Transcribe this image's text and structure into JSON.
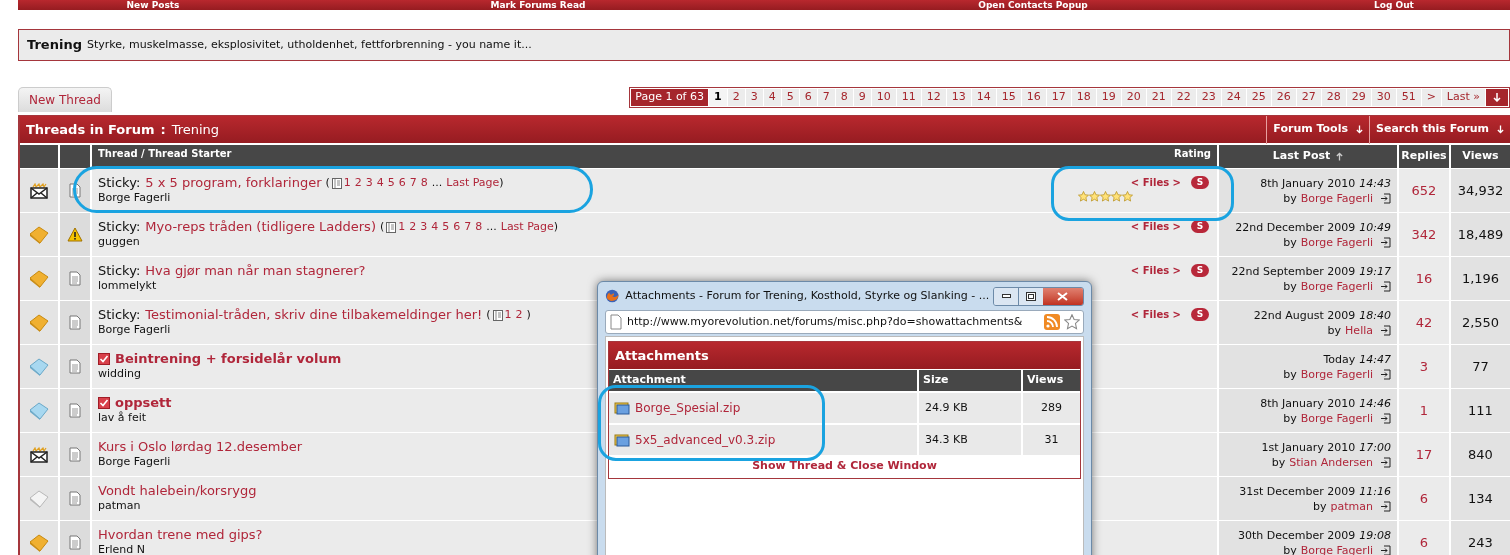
{
  "nav": [
    "New Posts",
    "Mark Forums Read",
    "Open Contacts Popup",
    "Log Out"
  ],
  "forum": {
    "title": "Trening",
    "description": "Styrke, muskelmasse, eksplosivitet, utholdenhet, fettforbrenning - you name it..."
  },
  "new_thread": "New Thread",
  "pagination": {
    "label": "Page 1 of 63",
    "pages": [
      {
        "label": "1",
        "selected": true
      },
      {
        "label": "2",
        "selected": false
      },
      {
        "label": "3",
        "selected": false
      },
      {
        "label": "4",
        "selected": false
      },
      {
        "label": "5",
        "selected": false
      },
      {
        "label": "6",
        "selected": false
      },
      {
        "label": "7",
        "selected": false
      },
      {
        "label": "8",
        "selected": false
      },
      {
        "label": "9",
        "selected": false
      },
      {
        "label": "10",
        "selected": false
      },
      {
        "label": "11",
        "selected": false
      },
      {
        "label": "12",
        "selected": false
      },
      {
        "label": "13",
        "selected": false
      },
      {
        "label": "14",
        "selected": false
      },
      {
        "label": "15",
        "selected": false
      },
      {
        "label": "16",
        "selected": false
      },
      {
        "label": "17",
        "selected": false
      },
      {
        "label": "18",
        "selected": false
      },
      {
        "label": "19",
        "selected": false
      },
      {
        "label": "20",
        "selected": false
      },
      {
        "label": "21",
        "selected": false
      },
      {
        "label": "22",
        "selected": false
      },
      {
        "label": "23",
        "selected": false
      },
      {
        "label": "24",
        "selected": false
      },
      {
        "label": "25",
        "selected": false
      },
      {
        "label": "26",
        "selected": false
      },
      {
        "label": "27",
        "selected": false
      },
      {
        "label": "28",
        "selected": false
      },
      {
        "label": "29",
        "selected": false
      },
      {
        "label": "30",
        "selected": false
      },
      {
        "label": "51",
        "selected": false
      },
      {
        "label": ">",
        "selected": false
      },
      {
        "label": "Last »",
        "selected": false
      }
    ]
  },
  "threads_header": {
    "title": "Threads in Forum",
    "separator": ":",
    "forum": "Trening",
    "tools": [
      "Forum Tools",
      "Search this Forum"
    ]
  },
  "columns": [
    "Thread / Thread Starter",
    "Rating",
    "Last Post",
    "Replies",
    "Views"
  ],
  "rows": [
    {
      "status_icon": {
        "kind": "envelope"
      },
      "post_icon": {
        "kind": "document"
      },
      "prefix": "Sticky:",
      "flagged": false,
      "title": "5 x 5 program, forklaringer",
      "page_links": {
        "open": "(",
        "pages": [
          "1",
          "2",
          "3",
          "4",
          "5",
          "6",
          "7",
          "8"
        ],
        "ellipsis": "...",
        "last": "Last Page",
        "close": ")"
      },
      "starter": "Borge Fagerli",
      "files": "< Files >",
      "badge": "S",
      "stars": 5,
      "last_post": {
        "date": "8th January 2010",
        "time": "14:43",
        "by": "by",
        "user": "Borge Fagerli"
      },
      "replies": "652",
      "views": "34,932"
    },
    {
      "status_icon": {
        "kind": "gold"
      },
      "post_icon": {
        "kind": "warning"
      },
      "prefix": "Sticky:",
      "flagged": false,
      "title": "Myo-reps tråden (tidligere Ladders)",
      "page_links": {
        "open": "(",
        "pages": [
          "1",
          "2",
          "3",
          "4",
          "5",
          "6",
          "7",
          "8"
        ],
        "ellipsis": "...",
        "last": "Last Page",
        "close": ")"
      },
      "starter": "guggen",
      "files": "< Files >",
      "badge": "S",
      "last_post": {
        "date": "22nd December 2009",
        "time": "10:49",
        "by": "by",
        "user": "Borge Fagerli"
      },
      "replies": "342",
      "views": "18,489"
    },
    {
      "status_icon": {
        "kind": "gold"
      },
      "post_icon": {
        "kind": "document"
      },
      "prefix": "Sticky:",
      "flagged": false,
      "title": "Hva gjør man når man stagnerer?",
      "starter": "lommelykt",
      "files": "< Files >",
      "badge": "S",
      "last_post": {
        "date": "22nd September 2009",
        "time": "19:17",
        "by": "by",
        "user": "Borge Fagerli"
      },
      "replies": "16",
      "views": "1,196"
    },
    {
      "status_icon": {
        "kind": "gold"
      },
      "post_icon": {
        "kind": "document"
      },
      "prefix": "Sticky:",
      "flagged": false,
      "title": "Testimonial-tråden, skriv dine tilbakemeldinger her!",
      "page_links": {
        "open": "(",
        "pages": [
          "1",
          "2"
        ],
        "close": ")"
      },
      "starter": "Borge Fagerli",
      "files": "< Files >",
      "badge": "S",
      "last_post": {
        "date": "22nd August 2009",
        "time": "18:40",
        "by": "by",
        "user": "Hella"
      },
      "replies": "42",
      "views": "2,550"
    },
    {
      "status_icon": {
        "kind": "blue"
      },
      "post_icon": {
        "kind": "document"
      },
      "flagged": true,
      "title": "Beintrening + forsidelår volum",
      "starter": "widding",
      "last_post": {
        "date": "Today",
        "time": "14:47",
        "by": "by",
        "user": "Borge Fagerli"
      },
      "replies": "3",
      "views": "77"
    },
    {
      "status_icon": {
        "kind": "blue"
      },
      "post_icon": {
        "kind": "document"
      },
      "flagged": true,
      "title": "oppsett",
      "starter": "lav å feit",
      "last_post": {
        "date": "8th January 2010",
        "time": "14:46",
        "by": "by",
        "user": "Borge Fagerli"
      },
      "replies": "1",
      "views": "111"
    },
    {
      "status_icon": {
        "kind": "envelope"
      },
      "post_icon": {
        "kind": "document"
      },
      "flagged": false,
      "title": "Kurs i Oslo lørdag 12.desember",
      "starter": "Borge Fagerli",
      "last_post": {
        "date": "1st January 2010",
        "time": "17:00",
        "by": "by",
        "user": "Stian Andersen"
      },
      "replies": "17",
      "views": "840"
    },
    {
      "status_icon": {
        "kind": "white"
      },
      "post_icon": {
        "kind": "document"
      },
      "flagged": false,
      "title": "Vondt halebein/korsrygg",
      "starter": "patman",
      "last_post": {
        "date": "31st December 2009",
        "time": "11:16",
        "by": "by",
        "user": "patman"
      },
      "replies": "6",
      "views": "134"
    },
    {
      "status_icon": {
        "kind": "gold"
      },
      "post_icon": {
        "kind": "document"
      },
      "flagged": false,
      "title": "Hvordan trene med gips?",
      "starter": "Erlend N",
      "last_post": {
        "date": "30th December 2009",
        "time": "19:08",
        "by": "by",
        "user": "Borge Fagerli"
      },
      "replies": "6",
      "views": "243"
    }
  ],
  "popup": {
    "title": "Attachments - Forum for Trening, Kosthold, Styrke og Slanking - ...",
    "url": "http://www.myorevolution.net/forums/misc.php?do=showattachments&",
    "heading": "Attachments",
    "columns": [
      "Attachment",
      "Size",
      "Views"
    ],
    "files": [
      {
        "name": "Borge_Spesial.zip",
        "size": "24.9 KB",
        "views": "289"
      },
      {
        "name": "5x5_advanced_v0.3.zip",
        "size": "34.3 KB",
        "views": "31"
      }
    ],
    "footer_link": "Show Thread & Close Window"
  }
}
